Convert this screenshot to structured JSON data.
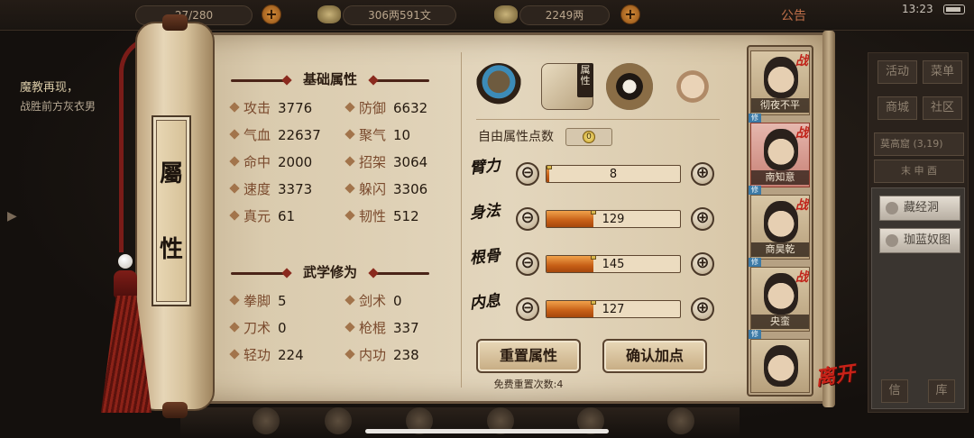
{
  "status": {
    "time": "13:23"
  },
  "topbar": {
    "stamina": "27/280",
    "copper": "306两591文",
    "gold": "2249两",
    "announcement": "公告"
  },
  "quest": {
    "title": "魔教再现，",
    "desc": "战胜前方灰衣男"
  },
  "right_menu": {
    "buttons": [
      "活动",
      "菜单",
      "商城",
      "社区"
    ],
    "location": "莫高窟",
    "coords": "(3,19)",
    "time_slots": "末 申 酉",
    "side_buttons": [
      "藏经洞",
      "珈蓝奴图"
    ],
    "bottom_buttons": [
      "信",
      "库"
    ]
  },
  "scroll": {
    "title_chars": [
      "屬",
      "性"
    ]
  },
  "basic_attrs": {
    "heading": "基础属性",
    "items": [
      {
        "name": "攻击",
        "value": "3776"
      },
      {
        "name": "防御",
        "value": "6632"
      },
      {
        "name": "气血",
        "value": "22637"
      },
      {
        "name": "聚气",
        "value": "10"
      },
      {
        "name": "命中",
        "value": "2000"
      },
      {
        "name": "招架",
        "value": "3064"
      },
      {
        "name": "速度",
        "value": "3373"
      },
      {
        "name": "躲闪",
        "value": "3306"
      },
      {
        "name": "真元",
        "value": "61"
      },
      {
        "name": "韧性",
        "value": "512"
      }
    ]
  },
  "martial": {
    "heading": "武学修为",
    "items": [
      {
        "name": "拳脚",
        "value": "5"
      },
      {
        "name": "剑术",
        "value": "0"
      },
      {
        "name": "刀术",
        "value": "0"
      },
      {
        "name": "枪棍",
        "value": "337"
      },
      {
        "name": "轻功",
        "value": "224"
      },
      {
        "name": "内功",
        "value": "238"
      }
    ]
  },
  "tabs": {
    "active_label": "属性",
    "icons": [
      "hat-icon",
      "attribute-book-icon",
      "bagua-icon",
      "meridian-body-icon"
    ]
  },
  "points": {
    "free_label": "自由属性点数",
    "free_value": "0",
    "attrs": [
      {
        "name": "臂力",
        "value": "8",
        "fill": 0.02
      },
      {
        "name": "身法",
        "value": "129",
        "fill": 0.35
      },
      {
        "name": "根骨",
        "value": "145",
        "fill": 0.35
      },
      {
        "name": "内息",
        "value": "127",
        "fill": 0.35
      }
    ],
    "minus_symbol": "⊖",
    "plus_symbol": "⊕"
  },
  "actions": {
    "reset": "重置属性",
    "confirm": "确认加点",
    "reset_count": "免费重置次数:4"
  },
  "party": {
    "members": [
      {
        "name": "彻夜不平",
        "battle_tag": "战",
        "cultivate_tag": "修"
      },
      {
        "name": "南知意",
        "battle_tag": "战",
        "cultivate_tag": "修"
      },
      {
        "name": "商昊乾",
        "battle_tag": "战",
        "cultivate_tag": "修"
      },
      {
        "name": "央蛮",
        "battle_tag": "战",
        "cultivate_tag": "修"
      },
      {
        "name": "",
        "battle_tag": "",
        "cultivate_tag": ""
      }
    ]
  },
  "leave_label": "离开",
  "colors": {
    "paper": "#e3d6bd",
    "accent_red": "#c0231a",
    "bar_fill": "#c65e16",
    "selected_member": "#c77f74"
  }
}
